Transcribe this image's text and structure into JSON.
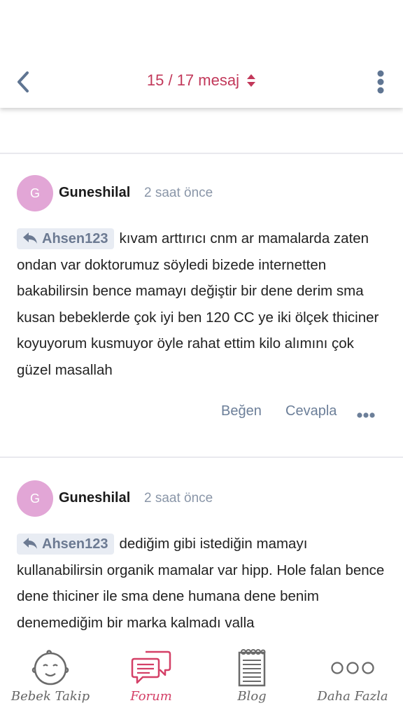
{
  "header": {
    "counter": "15 / 17 mesaj",
    "back_icon": "chevron-left-icon",
    "sort_icon": "sort-updown-icon",
    "menu_icon": "vertical-dots-icon",
    "accent_color": "#c2385a"
  },
  "posts": [
    {
      "avatar_letter": "G",
      "author": "Guneshilal",
      "time": "2 saat önce",
      "reply_to": "Ahsen123",
      "text": "kıvam arttırıcı cnm ar mamalarda zaten ondan var doktorumuz söyledi bizede internetten bakabilirsin bence mamayı değiştir bir dene derim sma kusan bebeklerde çok iyi ben 120 CC ye iki ölçek thiciner koyuyorum kusmuyor öyle rahat ettim kilo alımını çok güzel masallah",
      "like_label": "Beğen",
      "reply_label": "Cevapla"
    },
    {
      "avatar_letter": "G",
      "author": "Guneshilal",
      "time": "2 saat önce",
      "reply_to": "Ahsen123",
      "text": "dediğim gibi istediğin mamayı kullanabilirsin organik mamalar var hipp. Hole falan bence dene thiciner ile sma dene humana dene benim denemediğim bir marka kalmadı valla"
    }
  ],
  "tabbar": {
    "tabs": [
      {
        "label": "Bebek Takip",
        "icon": "baby-face-icon",
        "active": false
      },
      {
        "label": "Forum",
        "icon": "chat-bubbles-icon",
        "active": true
      },
      {
        "label": "Blog",
        "icon": "notepad-icon",
        "active": false
      },
      {
        "label": "Daha Fazla",
        "icon": "more-circles-icon",
        "active": false
      }
    ],
    "active_color": "#d44067",
    "inactive_color": "#666666"
  }
}
